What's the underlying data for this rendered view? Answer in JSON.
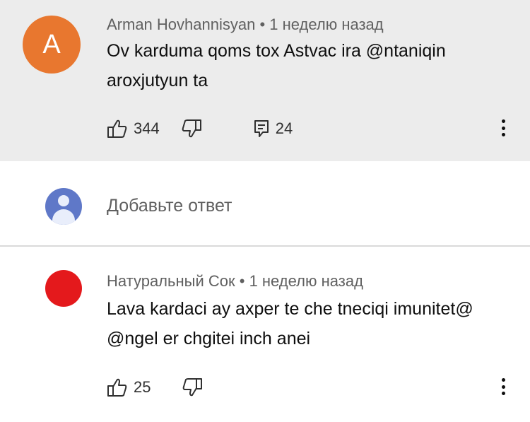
{
  "comments": [
    {
      "avatar_letter": "A",
      "avatar_color": "#e8772f",
      "author": "Arman Hovhannisyan",
      "separator": "•",
      "time": "1 неделю назад",
      "text": "Ov karduma qoms tox Astvac ira @ntaniqin aroxjutyun ta",
      "likes": "344",
      "replies": "24",
      "like_icon": "thumbs-up-icon",
      "dislike_icon": "thumbs-down-icon",
      "reply_icon": "reply-icon",
      "more_icon": "more-vert-icon"
    },
    {
      "avatar_color": "#e4191c",
      "author": "Натуральный Сок",
      "separator": "•",
      "time": "1 неделю назад",
      "text": "Lava kardaci ay axper te che tneciqi imunitet@ @ngel er chgitei inch anei",
      "likes": "25",
      "like_icon": "thumbs-up-icon",
      "dislike_icon": "thumbs-down-icon",
      "more_icon": "more-vert-icon"
    }
  ],
  "reply": {
    "placeholder": "Добавьте ответ",
    "avatar_icon": "default-user-icon",
    "avatar_color": "#5f78c8"
  },
  "colors": {
    "highlight_bg": "#ececec",
    "meta_text": "#606060",
    "body_text": "#0f0f0f"
  }
}
